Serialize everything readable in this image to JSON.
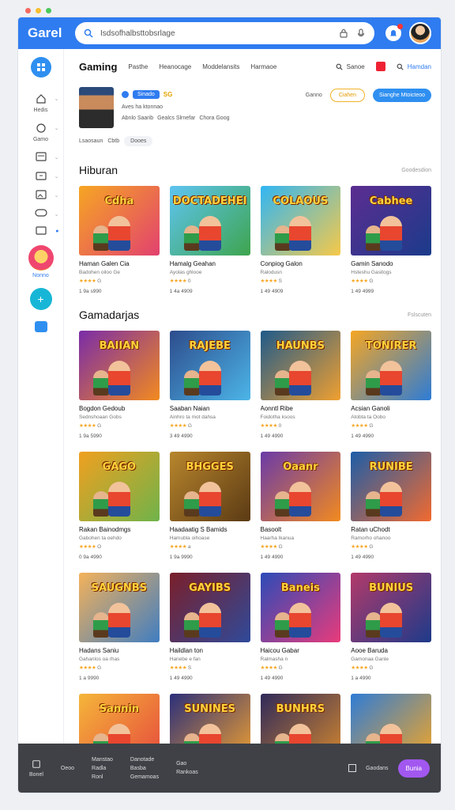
{
  "app": {
    "brand": "Garel"
  },
  "search": {
    "text": "Isdsofhalbsttobsrlage"
  },
  "nav": {
    "title": "Gaming",
    "items": [
      "Pasthe",
      "Heanocage",
      "Moddelansits",
      "Harmaoe"
    ],
    "right": {
      "search_label": "Sanoe",
      "user_label": "Hamdan"
    }
  },
  "sidebar": {
    "items": [
      {
        "label": "Hedis"
      },
      {
        "label": "Gamo"
      },
      {
        "label": ""
      },
      {
        "label": ""
      },
      {
        "label": ""
      },
      {
        "label": ""
      },
      {
        "label": ""
      }
    ],
    "active_label": "Nonno"
  },
  "profile": {
    "tag": "Sinado",
    "tag2": "SG",
    "line1": "Aves ha ktonnao",
    "line2": [
      "Abnlo Saarib",
      "Gealcs Slrnefar",
      "Chora Goog"
    ],
    "actions": {
      "text": "Ganno",
      "outline": "Ciahen",
      "primary": "Sianghe Mtoicteoo"
    },
    "chips": {
      "c1": "Lsaosaun",
      "c2": "Cbtb",
      "c3": "Dooes"
    }
  },
  "sections": [
    {
      "title": "Hiburan",
      "link": "Goodesdion",
      "cards": [
        {
          "title": "Haman Galen Cia",
          "banner": "Cdha",
          "sub": "Badohen oiloo Ge",
          "rating": "G",
          "count": "1 9a s990"
        },
        {
          "title": "Hamalg Geahan",
          "banner": "DOCTADEHEI",
          "sub": "Ayolas ghlooe",
          "rating": "0",
          "count": "1 4a 4909"
        },
        {
          "title": "Conpiog Galon",
          "banner": "COLAOUS",
          "sub": "Ralodusn",
          "rating": "S",
          "count": "1 49 4909"
        },
        {
          "title": "Gamin Sanodo",
          "banner": "Cabhee",
          "sub": "Hsteshu Gasitogs",
          "rating": "G",
          "count": "1 49 4999"
        }
      ]
    },
    {
      "title": "Gamadarjas",
      "link": "Fslscuten",
      "cards": [
        {
          "title": "Bogdon Gedoub",
          "banner": "BAIIAN",
          "sub": "Sednshoaan Gobs",
          "rating": "G",
          "count": "1 9a 5990"
        },
        {
          "title": "Saaban Naian",
          "banner": "RAJEBE",
          "sub": "Ainhro ta mot dahsa",
          "rating": "G",
          "count": "3 49 4990"
        },
        {
          "title": "Aonntl Ribe",
          "banner": "HAUNBS",
          "sub": "Foidotha ksoos",
          "rating": "0",
          "count": "1 49 4990"
        },
        {
          "title": "Acsian Ganoli",
          "banner": "TONIRER",
          "sub": "Atobta ta Oobo",
          "rating": "G",
          "count": "1 49 4990"
        }
      ]
    }
  ],
  "more_cards": [
    {
      "title": "Rakan Bainodmgs",
      "banner": "GAGO",
      "sub": "Gabohen ta oehdo",
      "rating": "O",
      "count": "0 9a 4990"
    },
    {
      "title": "Haadaatig S Bamids",
      "banner": "BHGGES",
      "sub": "Hamubla oihoase",
      "rating": "a",
      "count": "1 9a 9990"
    },
    {
      "title": "Basoolt",
      "banner": "Oaanr",
      "sub": "Haarha Ikanua",
      "rating": "G",
      "count": "1 49 4990"
    },
    {
      "title": "Ratan uChodt",
      "banner": "RUNIBE",
      "sub": "Ramorho ohanoo",
      "rating": "G",
      "count": "1 49 4990"
    },
    {
      "title": "Hadans Saniu",
      "banner": "SAUGNBS",
      "sub": "Gahanlos oa rhas",
      "rating": "G",
      "count": "1 a 9990"
    },
    {
      "title": "Haildlan ton",
      "banner": "GAYIBS",
      "sub": "Hanebe e fan",
      "rating": "S",
      "count": "1 49 4990"
    },
    {
      "title": "Haicou Gabar",
      "banner": "Baneis",
      "sub": "Ralmasha n",
      "rating": "G",
      "count": "1 49 4990"
    },
    {
      "title": "Aooe Baruda",
      "banner": "BUNIUS",
      "sub": "Gamonaa Ganle",
      "rating": "G",
      "count": "1 a 4990"
    },
    {
      "title": "",
      "banner": "Sannin",
      "sub": "",
      "rating": "",
      "count": ""
    },
    {
      "title": "",
      "banner": "SUNINES",
      "sub": "",
      "rating": "",
      "count": ""
    },
    {
      "title": "",
      "banner": "BUNHRS",
      "sub": "",
      "rating": "",
      "count": ""
    },
    {
      "title": "",
      "banner": "",
      "sub": "",
      "rating": "",
      "count": ""
    }
  ],
  "stars": "★★★★",
  "bottom": {
    "home_label": "Bonel",
    "c0": "Oeoo",
    "c1": [
      "Manstao",
      "Radla",
      "Ronl"
    ],
    "c2": [
      "Danotade",
      "Basba",
      "Gemamoas"
    ],
    "c3": [
      "Gao",
      "Rankoas"
    ],
    "right_label": "Gaodans",
    "primary": "Bunia"
  },
  "colors": {
    "accent": "#2f7cf0",
    "purple": "#a258f0",
    "window_dots": [
      "#f5685e",
      "#f8be2f",
      "#4bc95a"
    ]
  }
}
